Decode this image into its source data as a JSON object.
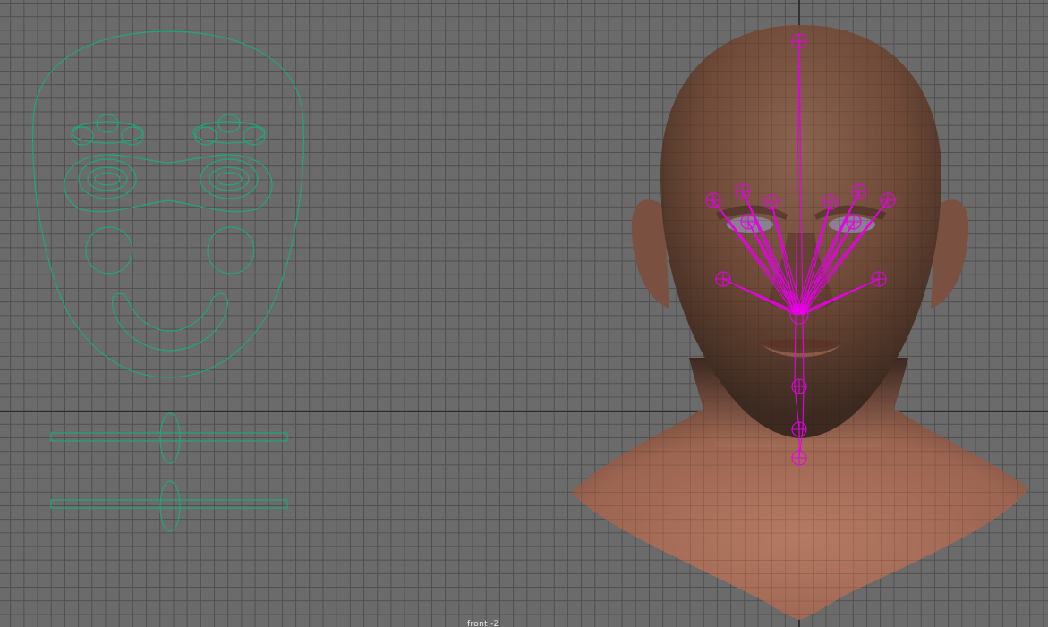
{
  "viewport": {
    "camera_label": "front -Z",
    "grid": "on",
    "colors": {
      "background": "#6b6b6b",
      "grid_line": "#4f4f4f",
      "axis_line": "#2c2c2c",
      "nurbs_controls": "#1fa77a",
      "joints": "#e600e6",
      "skin": "#8a5d45"
    }
  },
  "controls": {
    "face_board": "face-control-curve",
    "sliders": [
      "slider-1",
      "slider-2"
    ]
  },
  "model": {
    "subject": "head-and-shoulders-mesh",
    "joint_color": "#e600e6"
  }
}
